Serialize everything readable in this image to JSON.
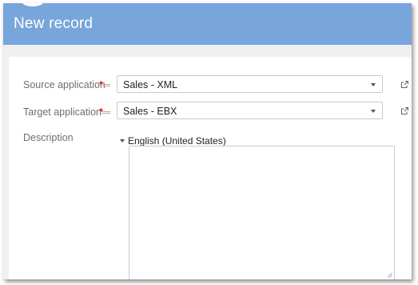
{
  "dialog": {
    "title": "New record"
  },
  "fields": {
    "source": {
      "label": "Source application",
      "value": "Sales - XML"
    },
    "target": {
      "label": "Target application",
      "value": "Sales - EBX"
    },
    "description": {
      "label": "Description",
      "locale": "English (United States)",
      "value": ""
    }
  },
  "colors": {
    "header": "#78a6db",
    "required": "#d33b3b"
  }
}
